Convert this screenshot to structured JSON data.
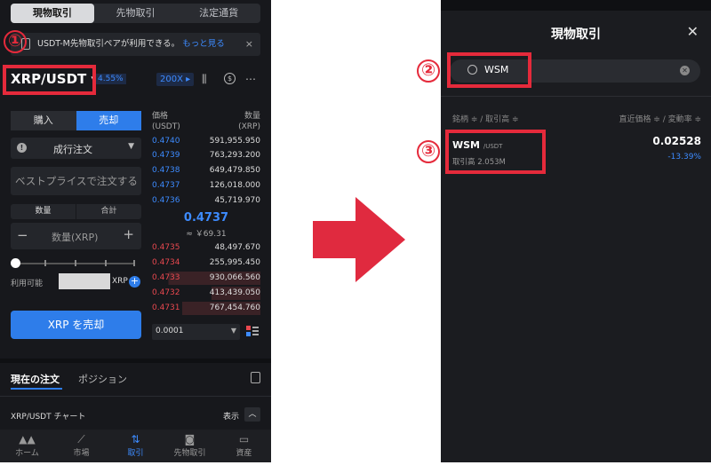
{
  "left": {
    "tabs": [
      "現物取引",
      "先物取引",
      "法定通貨"
    ],
    "banner": {
      "text": "USDT-M先物取引ペアが利用できる。",
      "link": "もっと見る",
      "close": "×"
    },
    "pair": "XRP/USDT ▾",
    "change_pct": "4.55%",
    "leverage": "200X ▸",
    "buy_tab": "購入",
    "sell_tab": "売却",
    "order_type": "成行注文",
    "best_price_placeholder": "ベストプライスで注文する",
    "qty_tab": "数量",
    "total_tab": "合計",
    "qty_placeholder": "数量(XRP)",
    "minus": "−",
    "plus": "+",
    "available_label": "利用可能",
    "available_unit": "XRP",
    "sell_button": "XRP を売却",
    "orderbook": {
      "price_header": "価格\n(USDT)",
      "qty_header": "数量\n(XRP)",
      "bids": [
        {
          "p": "0.4740",
          "q": "591,955.950"
        },
        {
          "p": "0.4739",
          "q": "763,293.200"
        },
        {
          "p": "0.4738",
          "q": "649,479.850"
        },
        {
          "p": "0.4737",
          "q": "126,018.000"
        },
        {
          "p": "0.4736",
          "q": "45,719.970"
        }
      ],
      "mid_price": "0.4737",
      "mid_jpy": "≈ ￥69.31",
      "asks": [
        {
          "p": "0.4735",
          "q": "48,497.670"
        },
        {
          "p": "0.4734",
          "q": "255,995.450"
        },
        {
          "p": "0.4733",
          "q": "930,066.560"
        },
        {
          "p": "0.4732",
          "q": "413,439.050"
        },
        {
          "p": "0.4731",
          "q": "767,454.760"
        }
      ],
      "precision": "0.0001"
    },
    "orders_tab": "現在の注文",
    "positions_tab": "ポジション",
    "chart_label": "XRP/USDT チャート",
    "show_label": "表示",
    "nav": [
      {
        "icon": "▲▲",
        "label": "ホーム"
      },
      {
        "icon": "⟋",
        "label": "市場"
      },
      {
        "icon": "⇅",
        "label": "取引"
      },
      {
        "icon": "◙",
        "label": "先物取引"
      },
      {
        "icon": "▭",
        "label": "資産"
      }
    ]
  },
  "right": {
    "title": "現物取引",
    "close": "✕",
    "search_value": "WSM",
    "col_left": "銘柄 ≑ / 取引高 ≑",
    "col_right": "直近価格 ≑ / 変動率 ≑",
    "item": {
      "symbol": "WSM",
      "quote": "/USDT",
      "volume": "取引高 2.053M",
      "price": "0.02528",
      "change": "-13.39%"
    }
  },
  "markers": [
    "①",
    "②",
    "③"
  ],
  "colors": {
    "accent": "#2e7dea",
    "marker": "#e52a3b",
    "bid": "#3d8bff",
    "ask": "#e8484f"
  }
}
